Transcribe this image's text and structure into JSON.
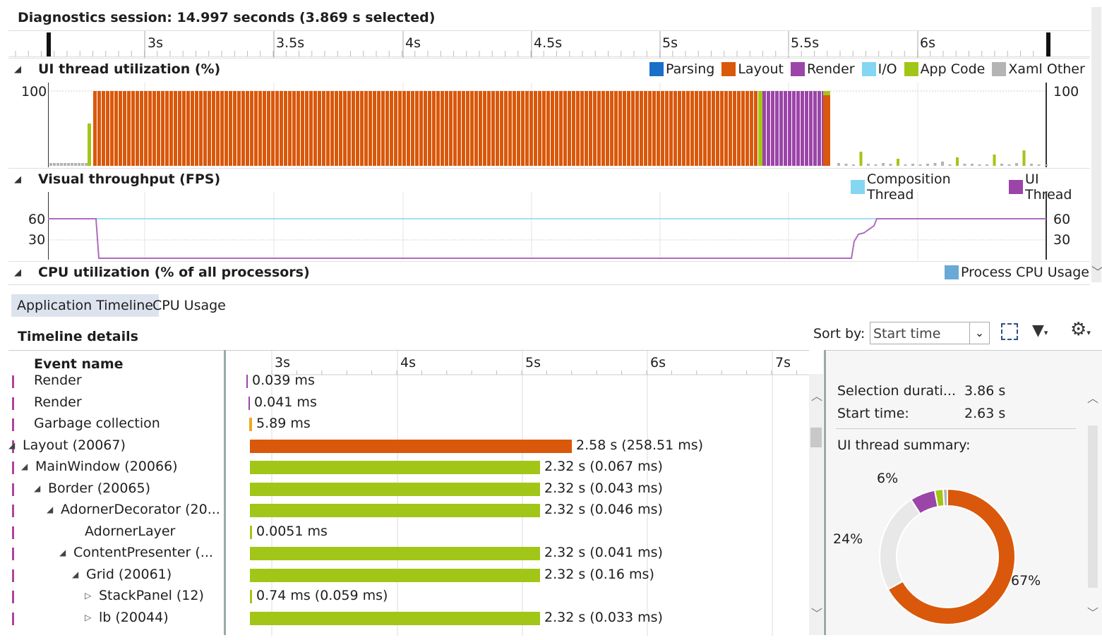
{
  "session": {
    "title": "Diagnostics session: 14.997 seconds (3.869 s selected)"
  },
  "ruler_top": {
    "ticks": [
      "3s",
      "3.5s",
      "4s",
      "4.5s",
      "5s",
      "5.5s",
      "6s"
    ]
  },
  "ui_thread": {
    "title": "UI thread utilization (%)",
    "legend": [
      {
        "label": "Parsing",
        "color": "#1a6fc8"
      },
      {
        "label": "Layout",
        "color": "#d9580b"
      },
      {
        "label": "Render",
        "color": "#9b45a8"
      },
      {
        "label": "I/O",
        "color": "#84d6f2"
      },
      {
        "label": "App Code",
        "color": "#a2c617"
      },
      {
        "label": "Xaml Other",
        "color": "#b4b4b4"
      }
    ],
    "y_left": "100",
    "y_right": "100"
  },
  "visual_throughput": {
    "title": "Visual throughput (FPS)",
    "legend": [
      {
        "label": "Composition Thread",
        "color": "#84d6f2"
      },
      {
        "label": "UI Thread",
        "color": "#9b45a8"
      }
    ],
    "y_left": [
      "60",
      "30"
    ],
    "y_right": [
      "60",
      "30"
    ]
  },
  "cpu_util": {
    "title": "CPU utilization (% of all processors)",
    "legend": [
      {
        "label": "Process CPU Usage",
        "color": "#6aa9d6"
      }
    ]
  },
  "tabs": [
    "Application Timeline",
    "CPU Usage"
  ],
  "details": {
    "title": "Timeline details",
    "sort_label": "Sort by:",
    "sort_value": "Start time",
    "col_header": "Event name",
    "ruler": [
      "3s",
      "4s",
      "5s",
      "6s",
      "7s"
    ],
    "rows": [
      {
        "name": "Render",
        "value": "0.039 ms",
        "color": "#9b45a8"
      },
      {
        "name": "Render",
        "value": "0.041 ms",
        "color": "#9b45a8"
      },
      {
        "name": "Garbage collection",
        "value": "5.89 ms",
        "color": "#f0a81c"
      },
      {
        "name": "Layout (20067)",
        "value": "2.58 s (258.51 ms)",
        "color": "#d9580b"
      },
      {
        "name": "MainWindow (20066)",
        "value": "2.32 s (0.067 ms)",
        "color": "#a2c617"
      },
      {
        "name": "Border (20065)",
        "value": "2.32 s (0.043 ms)",
        "color": "#a2c617"
      },
      {
        "name": "AdornerDecorator (20...",
        "value": "2.32 s (0.046 ms)",
        "color": "#a2c617"
      },
      {
        "name": "AdornerLayer",
        "value": "0.0051 ms",
        "color": "#a2c617"
      },
      {
        "name": "ContentPresenter (...",
        "value": "2.32 s (0.041 ms)",
        "color": "#a2c617"
      },
      {
        "name": "Grid (20061)",
        "value": "2.32 s (0.16 ms)",
        "color": "#a2c617"
      },
      {
        "name": "StackPanel (12)",
        "value": "0.74 ms (0.059 ms)",
        "color": "#a2c617"
      },
      {
        "name": "lb (20044)",
        "value": "2.32 s (0.033 ms)",
        "color": "#a2c617"
      }
    ]
  },
  "summary": {
    "selection_label": "Selection durati...",
    "selection_value": "3.86 s",
    "start_label": "Start time:",
    "start_value": "2.63 s",
    "ui_summary_label": "UI thread summary:",
    "pie_labels": {
      "layout": "67%",
      "other": "24%",
      "render": "6%"
    },
    "chart_data": {
      "type": "pie",
      "categories": [
        "Layout",
        "Xaml Other",
        "Render",
        "App Code",
        "I/O"
      ],
      "values": [
        67,
        24,
        6,
        2,
        1
      ]
    }
  }
}
